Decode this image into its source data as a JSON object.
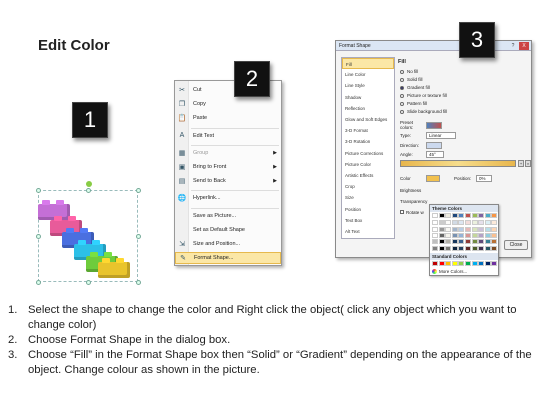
{
  "page": {
    "title": "Edit Color",
    "badges": [
      "1",
      "2",
      "3"
    ]
  },
  "shape": {
    "brick_colors": [
      "#c46fd6",
      "#e85b9a",
      "#4a6fe0",
      "#2cc0e8",
      "#6ecc3c",
      "#e9c42c"
    ]
  },
  "context_menu": {
    "items": [
      {
        "icon": "scissors-icon",
        "glyph": "✂",
        "label": "Cut",
        "disabled": false,
        "submenu": false
      },
      {
        "icon": "copy-icon",
        "glyph": "❐",
        "label": "Copy",
        "disabled": false,
        "submenu": false
      },
      {
        "icon": "paste-icon",
        "glyph": "📋",
        "label": "Paste",
        "disabled": false,
        "submenu": false
      },
      {
        "icon": "edit-text-icon",
        "glyph": "A",
        "label": "Edit Text",
        "disabled": false,
        "submenu": false
      },
      {
        "icon": "group-icon",
        "glyph": "▦",
        "label": "Group",
        "disabled": true,
        "submenu": true
      },
      {
        "icon": "bring-front-icon",
        "glyph": "▣",
        "label": "Bring to Front",
        "disabled": false,
        "submenu": true
      },
      {
        "icon": "send-back-icon",
        "glyph": "▤",
        "label": "Send to Back",
        "disabled": false,
        "submenu": true
      },
      {
        "icon": "hyperlink-icon",
        "glyph": "🌐",
        "label": "Hyperlink...",
        "disabled": false,
        "submenu": false
      },
      {
        "icon": "",
        "glyph": "",
        "label": "Save as Picture...",
        "disabled": false,
        "submenu": false
      },
      {
        "icon": "",
        "glyph": "",
        "label": "Set as Default Shape",
        "disabled": false,
        "submenu": false
      },
      {
        "icon": "size-position-icon",
        "glyph": "⇲",
        "label": "Size and Position...",
        "disabled": false,
        "submenu": false
      },
      {
        "icon": "format-shape-icon",
        "glyph": "✎",
        "label": "Format Shape...",
        "disabled": false,
        "submenu": false,
        "highlighted": true
      }
    ]
  },
  "dialog": {
    "title": "Format Shape",
    "help": "?",
    "close": "X",
    "nav": [
      "Fill",
      "Line Color",
      "Line Style",
      "Shadow",
      "Reflection",
      "Glow and Soft Edges",
      "3-D Format",
      "3-D Rotation",
      "Picture Corrections",
      "Picture Color",
      "Artistic Effects",
      "Crop",
      "Size",
      "Position",
      "Text Box",
      "Alt Text"
    ],
    "selected_nav": "Fill",
    "section_title": "Fill",
    "fill_options": [
      "No fill",
      "Solid fill",
      "Gradient fill",
      "Picture or texture fill",
      "Pattern fill",
      "Slide background fill"
    ],
    "selected_fill": "Gradient fill",
    "preset_label": "Preset colors:",
    "type_label": "Type:",
    "type_value": "Linear",
    "direction_label": "Direction:",
    "angle_label": "Angle:",
    "angle_value": "45°",
    "stops_label": "Gradient stops",
    "color_label": "Color",
    "position_label": "Position:",
    "position_value": "0%",
    "brightness_label": "Brightness",
    "transparency_label": "Transparency",
    "rotate_label": "Rotate w",
    "close_button": "Close",
    "popup": {
      "theme_label": "Theme Colors",
      "standard_label": "Standard Colors",
      "more_label": "More Colors...",
      "theme_top": [
        "#ffffff",
        "#000000",
        "#eeece1",
        "#1f497d",
        "#4f81bd",
        "#c0504d",
        "#9bbb59",
        "#8064a2",
        "#4bacc6",
        "#f79646"
      ],
      "standard": [
        "#c00000",
        "#ff0000",
        "#ffc000",
        "#ffff00",
        "#92d050",
        "#00b050",
        "#00b0f0",
        "#0070c0",
        "#002060",
        "#7030a0"
      ]
    }
  },
  "instructions": [
    {
      "num": "1.",
      "text": "Select the shape to change the color and Right click the object( click any object which you want to change color)"
    },
    {
      "num": "2.",
      "text": "Choose Format Shape in the dialog box."
    },
    {
      "num": "3.",
      "text": "Choose “Fill” in the Format Shape box then “Solid” or “Gradient” depending on the appearance of the object. Change colour as shown in the picture."
    }
  ]
}
